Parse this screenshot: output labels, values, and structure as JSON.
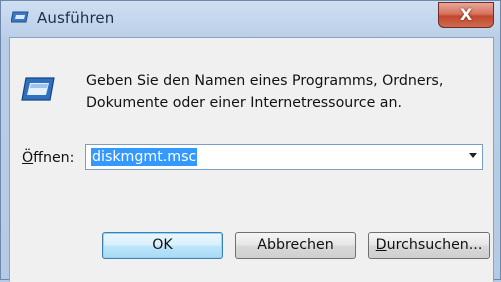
{
  "window": {
    "title": "Ausführen",
    "close_glyph": "X",
    "title_icon": "run-icon"
  },
  "dialog": {
    "icon": "run-dialog-icon",
    "description_line1": "Geben Sie den Namen eines Programms, Ordners,",
    "description_line2": "Dokumente oder einer Internetressource an.",
    "open_label_accel": "Ö",
    "open_label_rest": "ffnen:",
    "open_value": "diskmgmt.msc"
  },
  "buttons": {
    "ok": "OK",
    "cancel": "Abbrechen",
    "browse_accel": "D",
    "browse_rest": "urchsuchen..."
  },
  "colors": {
    "selection": "#3399ff",
    "close_button": "#c2482f",
    "frame": "#b8cde6"
  }
}
